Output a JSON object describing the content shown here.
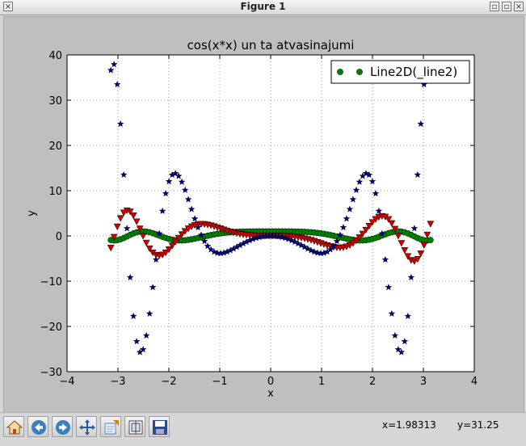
{
  "window": {
    "title": "Figure 1"
  },
  "chart_data": {
    "type": "scatter",
    "title": "cos(x*x) un ta atvasinajumi",
    "xlabel": "x",
    "ylabel": "y",
    "xlim": [
      -4,
      4
    ],
    "ylim": [
      -30,
      40
    ],
    "xticks": [
      -4,
      -3,
      -2,
      -1,
      0,
      1,
      2,
      3,
      4
    ],
    "yticks": [
      -30,
      -20,
      -10,
      0,
      10,
      20,
      30,
      40
    ],
    "xtick_labels": [
      "−4",
      "−3",
      "−2",
      "−1",
      "0",
      "1",
      "2",
      "3",
      "4"
    ],
    "ytick_labels": [
      "−30",
      "−20",
      "−10",
      "0",
      "10",
      "20",
      "30",
      "40"
    ],
    "grid": true,
    "legend": {
      "placement": "top-right",
      "entries": [
        "Line2D(_line2)"
      ]
    },
    "x_sample": {
      "start": -3.14,
      "end": 3.14,
      "count": 100
    },
    "series": [
      {
        "function": "cos(x*x)",
        "marker": "circle",
        "color": "#007f00"
      },
      {
        "function": "-2*x*sin(x*x)",
        "marker": "triangle-down",
        "color": "#cc0000"
      },
      {
        "function": "-2*sin(x*x) - 4*x*x*cos(x*x)",
        "marker": "star",
        "color": "#000080"
      }
    ]
  },
  "toolbar": {
    "home_label": "home-icon",
    "back_label": "back-icon",
    "forward_label": "forward-icon",
    "pan_label": "pan-icon",
    "zoom_label": "zoom-icon",
    "subplots_label": "subplots-icon",
    "save_label": "save-icon",
    "x_readout": "x=1.98313",
    "y_readout": "y=31.25"
  }
}
